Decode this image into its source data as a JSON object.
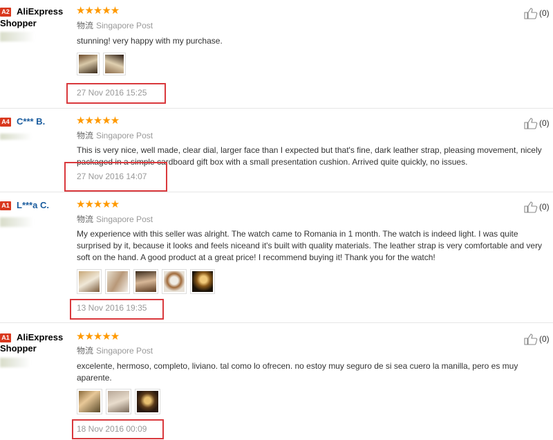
{
  "logistics_label": "物流",
  "star_glyphs": "★★★★★",
  "like_icon": "thumbs-up-icon",
  "colors": {
    "star": "#ff9900",
    "badge": "#d9381e",
    "highlight_box": "#d9383c",
    "user_blue": "#1a5c9e"
  },
  "reviews": [
    {
      "badge": "A2",
      "user": "AliExpress",
      "user2": "Shopper",
      "rating": 5,
      "shipping": "Singapore Post",
      "text": "stunning! very happy with my purchase.",
      "date": "27 Nov 2016 15:25",
      "likes": "(0)"
    },
    {
      "badge": "A4",
      "user": "C*** B.",
      "rating": 5,
      "shipping": "Singapore Post",
      "text": "This is very nice, well made, clear dial, larger face than I expected but that's fine, dark leather strap, pleasing movement, nicely packaged in a simple cardboard gift box with a small presentation cushion. Arrived quite quickly, no issues.",
      "date": "27 Nov 2016 14:07",
      "likes": "(0)"
    },
    {
      "badge": "A1",
      "user": "L***a C.",
      "rating": 5,
      "shipping": "Singapore Post",
      "text": "My experience with this seller was alright. The watch came to Romania in 1 month. The watch is indeed light. I was quite surprised by it, because it looks and feels niceand it's built with quality materials. The leather strap is very comfortable and very soft on the hand. A good product at a great price! I recommend buying it! Thank you for the watch!",
      "date": "13 Nov 2016 19:35",
      "likes": "(0)"
    },
    {
      "badge": "A1",
      "user": "AliExpress",
      "user2": "Shopper",
      "rating": 5,
      "shipping": "Singapore Post",
      "text": "excelente, hermoso, completo, liviano. tal como lo ofrecen. no estoy muy seguro de si sea cuero la manilla, pero es muy aparente.",
      "date": "18 Nov 2016 00:09",
      "likes": "(0)"
    }
  ]
}
